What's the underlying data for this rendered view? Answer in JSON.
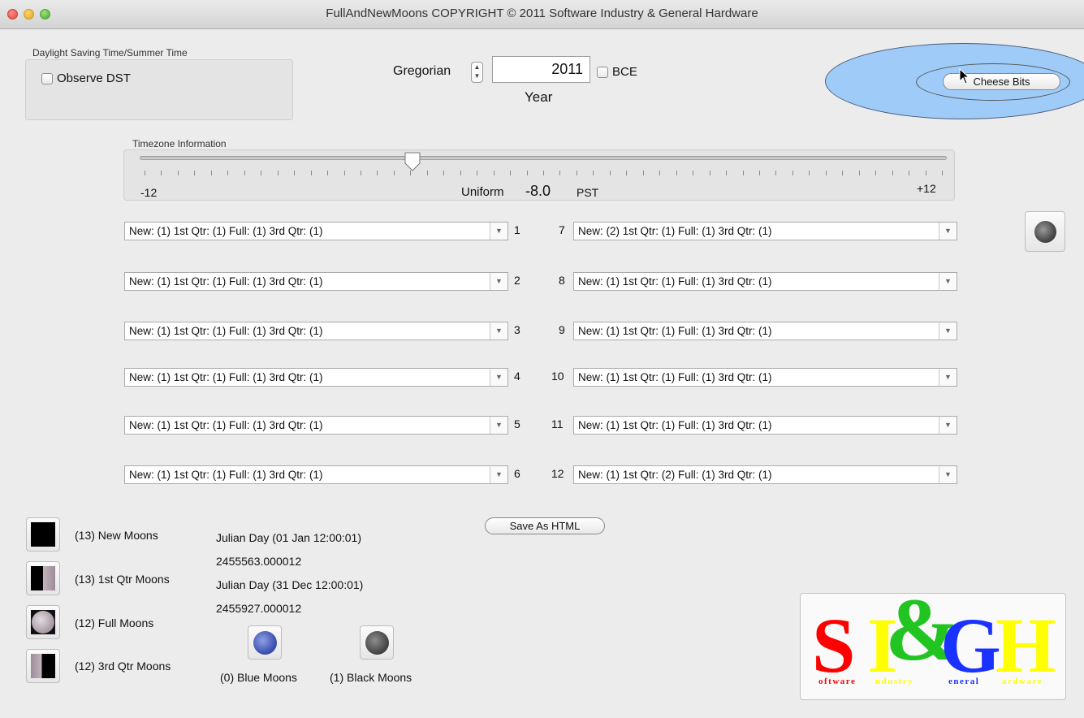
{
  "window": {
    "title": "FullAndNewMoons COPYRIGHT © 2011 Software Industry & General Hardware"
  },
  "dst": {
    "group_label": "Daylight Saving Time/Summer Time",
    "checkbox_label": "Observe DST",
    "checked": false
  },
  "year": {
    "calendar": "Gregorian",
    "value": "2011",
    "bce_label": "BCE",
    "caption": "Year"
  },
  "cheese": {
    "button_label": "Cheese Bits",
    "ellipse_color": "#9ecbf7"
  },
  "timezone": {
    "group_label": "Timezone Information",
    "min_label": "-12",
    "max_label": "+12",
    "mode_label": "Uniform",
    "offset_value": "-8.0",
    "zone_label": "PST",
    "slider_value": -8.0
  },
  "months_left": [
    {
      "num": "1",
      "summary": "New: (1) 1st Qtr: (1) Full: (1) 3rd Qtr: (1)"
    },
    {
      "num": "2",
      "summary": "New: (1) 1st Qtr: (1) Full: (1) 3rd Qtr: (1)"
    },
    {
      "num": "3",
      "summary": "New: (1) 1st Qtr: (1) Full: (1) 3rd Qtr: (1)"
    },
    {
      "num": "4",
      "summary": "New: (1) 1st Qtr: (1) Full: (1) 3rd Qtr: (1)"
    },
    {
      "num": "5",
      "summary": "New: (1) 1st Qtr: (1) Full: (1) 3rd Qtr: (1)"
    },
    {
      "num": "6",
      "summary": "New: (1) 1st Qtr: (1) Full: (1) 3rd Qtr: (1)"
    }
  ],
  "months_right": [
    {
      "num": "7",
      "summary": "New: (2) 1st Qtr: (1) Full: (1) 3rd Qtr: (1)"
    },
    {
      "num": "8",
      "summary": "New: (1) 1st Qtr: (1) Full: (1) 3rd Qtr: (1)"
    },
    {
      "num": "9",
      "summary": "New: (1) 1st Qtr: (1) Full: (1) 3rd Qtr: (1)"
    },
    {
      "num": "10",
      "summary": "New: (1) 1st Qtr: (1) Full: (1) 3rd Qtr: (1)"
    },
    {
      "num": "11",
      "summary": "New: (1) 1st Qtr: (1) Full: (1) 3rd Qtr: (1)"
    },
    {
      "num": "12",
      "summary": "New: (1) 1st Qtr: (2) Full: (1) 3rd Qtr: (1)"
    }
  ],
  "save_button": "Save As HTML",
  "totals": {
    "new": "(13) New Moons",
    "first_qtr": "(13) 1st Qtr Moons",
    "full": "(12) Full Moons",
    "third_qtr": "(12) 3rd Qtr Moons",
    "blue": "(0) Blue Moons",
    "black": "(1) Black Moons"
  },
  "julian": {
    "start_label": "Julian Day (01 Jan 12:00:01)",
    "start_value": "2455563.000012",
    "end_label": "Julian Day (31 Dec 12:00:01)",
    "end_value": "2455927.000012"
  },
  "logo": {
    "letters": [
      "S",
      "I",
      "&",
      "G",
      "H"
    ],
    "words": [
      "oftware",
      "ndustry",
      "eneral",
      "ardware"
    ],
    "colors": {
      "s": "#ff0000",
      "i": "#ffff00",
      "amp": "#22c422",
      "g": "#1a32ff",
      "h": "#ffff00"
    }
  },
  "icons": {
    "moon_top_right": "moon-phase-icon",
    "new": "new-moon-icon",
    "first": "first-quarter-moon-icon",
    "full": "full-moon-icon",
    "third": "third-quarter-moon-icon",
    "blue": "blue-moon-icon",
    "black": "black-moon-icon"
  }
}
